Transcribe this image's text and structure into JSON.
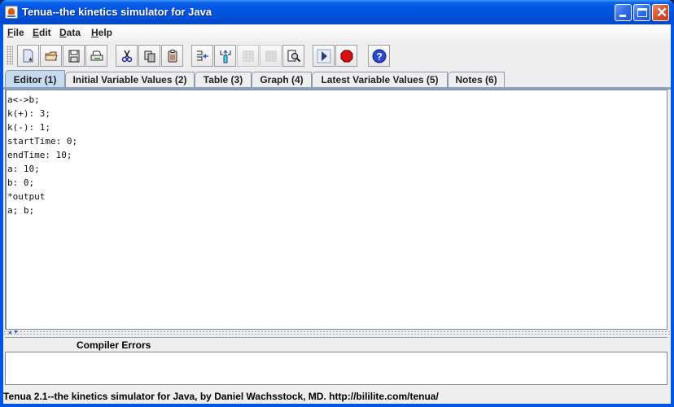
{
  "window": {
    "title": "Tenua--the kinetics simulator for Java",
    "controls": {
      "minimize": "minimize",
      "maximize": "maximize",
      "close": "close"
    }
  },
  "menu": {
    "items": [
      {
        "label": "File",
        "mnemonic": "F"
      },
      {
        "label": "Edit",
        "mnemonic": "E"
      },
      {
        "label": "Data",
        "mnemonic": "D"
      },
      {
        "label": "Help",
        "mnemonic": "H"
      }
    ]
  },
  "toolbar": {
    "buttons": [
      {
        "icon": "new-file-icon",
        "enabled": true
      },
      {
        "icon": "open-folder-icon",
        "enabled": true
      },
      {
        "icon": "save-icon",
        "enabled": true
      },
      {
        "icon": "print-icon",
        "enabled": true
      },
      {
        "icon": "cut-icon",
        "enabled": true
      },
      {
        "icon": "copy-icon",
        "enabled": true
      },
      {
        "icon": "paste-icon",
        "enabled": true
      },
      {
        "icon": "insert-left-icon",
        "enabled": true
      },
      {
        "icon": "insert-down-icon",
        "enabled": true
      },
      {
        "icon": "table-icon",
        "enabled": false
      },
      {
        "icon": "grid-icon",
        "enabled": false
      },
      {
        "icon": "find-icon",
        "enabled": true
      },
      {
        "icon": "run-icon",
        "enabled": true
      },
      {
        "icon": "stop-icon",
        "enabled": true
      },
      {
        "icon": "help-icon",
        "enabled": true
      }
    ]
  },
  "tabs": [
    {
      "label": "Editor (1)",
      "active": true
    },
    {
      "label": "Initial Variable Values (2)",
      "active": false
    },
    {
      "label": "Table (3)",
      "active": false
    },
    {
      "label": "Graph (4)",
      "active": false
    },
    {
      "label": "Latest Variable Values (5)",
      "active": false
    },
    {
      "label": "Notes (6)",
      "active": false
    }
  ],
  "editor": {
    "lines": [
      "a<->b;",
      "k(+): 3;",
      "k(-): 1;",
      "startTime: 0;",
      "endTime: 10;",
      "a: 10;",
      "b: 0;",
      "*output",
      "a; b;"
    ]
  },
  "errors": {
    "title": "Compiler Errors",
    "content": ""
  },
  "status": {
    "text": "Tenua 2.1--the kinetics simulator for Java, by Daniel Wachsstock, MD. http://bililite.com/tenua/"
  }
}
